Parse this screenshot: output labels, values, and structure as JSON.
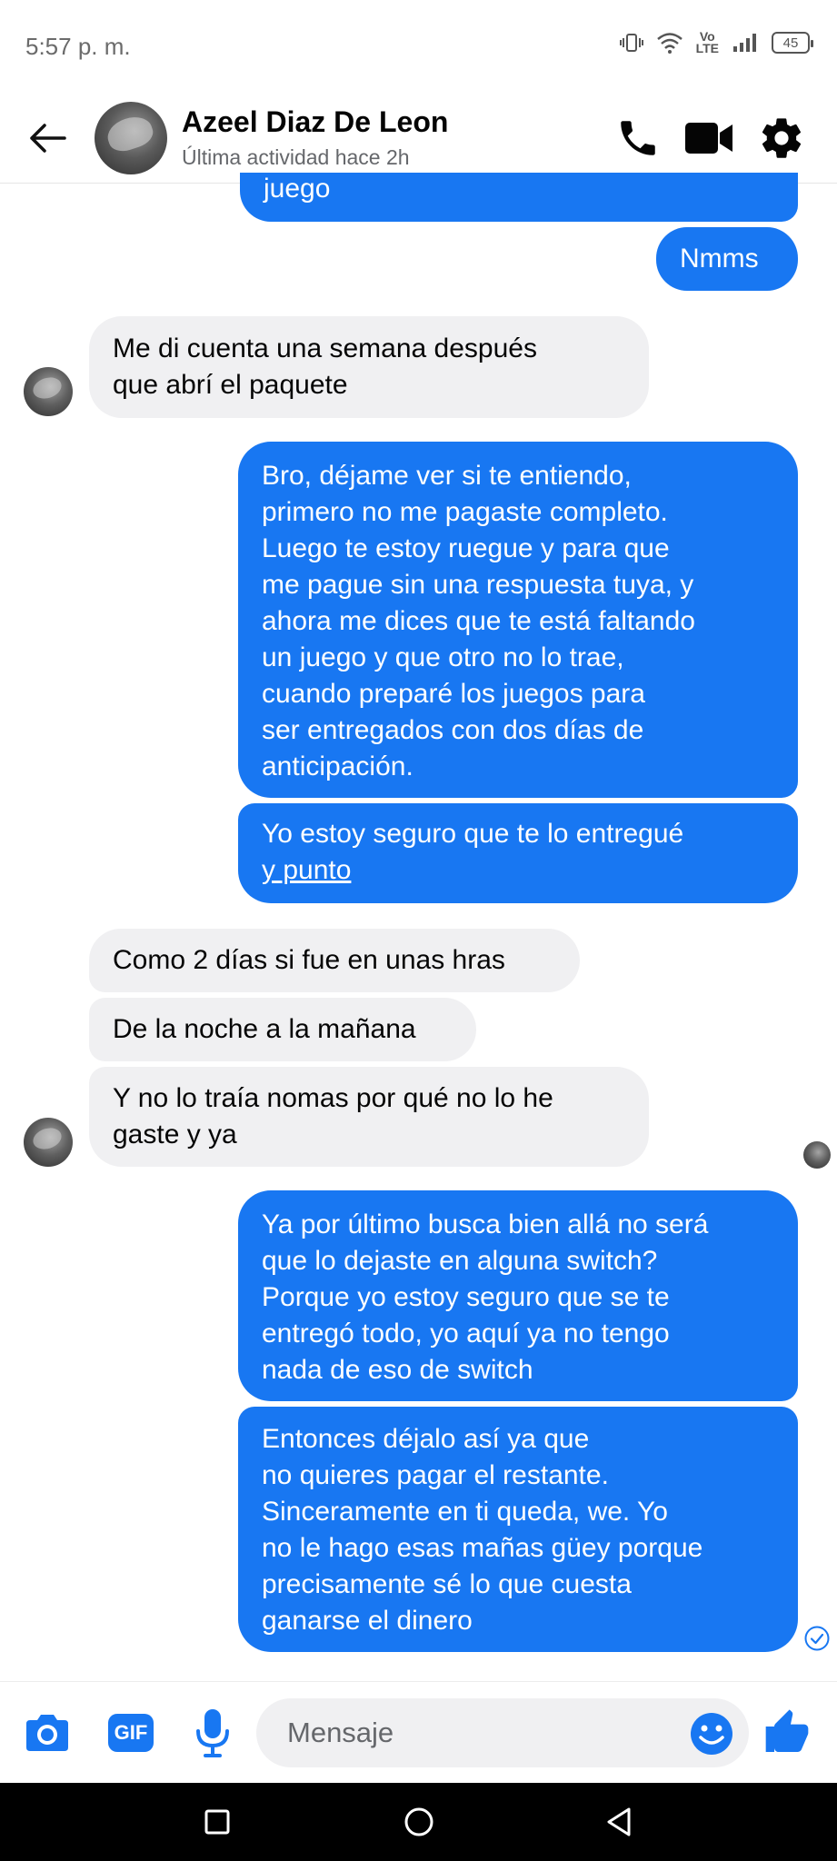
{
  "status_bar": {
    "time": "5:57 p. m.",
    "vol_top": "Vo",
    "vol_bottom": "LTE",
    "battery": "45",
    "icons": [
      "vibrate-icon",
      "wifi-icon",
      "volte-icon",
      "signal-icon",
      "battery-icon"
    ]
  },
  "header": {
    "name": "Azeel Diaz De Leon",
    "status": "Última actividad hace 2h",
    "icons": [
      "back-arrow-icon",
      "phone-icon",
      "video-camera-icon",
      "gear-icon"
    ]
  },
  "messages": [
    {
      "sender": "me",
      "lines": [
        "juego"
      ]
    },
    {
      "sender": "me",
      "lines": [
        "Nmms"
      ]
    },
    {
      "sender": "contact",
      "lines": [
        "Me di cuenta una semana después",
        "que abrí el paquete"
      ]
    },
    {
      "sender": "me",
      "lines": [
        "Bro, déjame ver si te entiendo,",
        "primero no me pagaste completo.",
        "Luego te estoy ruegue y para que",
        "me pague sin una respuesta tuya, y",
        "ahora me dices que te está faltando",
        "un juego y que otro no lo trae,",
        "cuando preparé los juegos para",
        "ser entregados con dos días de",
        "anticipación."
      ]
    },
    {
      "sender": "me",
      "lines": [
        "Yo estoy seguro que te lo entregué",
        "y punto"
      ]
    },
    {
      "sender": "contact",
      "lines": [
        "Como 2 días si fue en unas hras"
      ]
    },
    {
      "sender": "contact",
      "lines": [
        "De la noche a la mañana"
      ]
    },
    {
      "sender": "contact",
      "lines": [
        "Y no lo traía nomas por qué no lo he",
        "gaste y ya"
      ]
    },
    {
      "sender": "me",
      "lines": [
        "Ya por último busca bien allá no será",
        "que lo dejaste en alguna switch?",
        "Porque yo estoy seguro que se te",
        "entregó todo, yo aquí ya no tengo",
        "nada de eso de switch"
      ]
    },
    {
      "sender": "me",
      "lines": [
        "Entonces déjalo así ya que",
        "no quieres pagar el restante.",
        "Sinceramente en ti queda, we.  Yo",
        "no le hago esas mañas güey porque",
        "precisamente sé lo que cuesta",
        "ganarse el dinero"
      ]
    }
  ],
  "composer": {
    "placeholder": "Mensaje",
    "gif_label": "GIF",
    "icons": [
      "camera-icon",
      "gif-icon",
      "microphone-icon",
      "emoji-icon",
      "thumbs-up-icon"
    ]
  },
  "colors": {
    "accent": "#1877f2",
    "incoming_bubble": "#f0f0f2",
    "text": "#050505",
    "muted": "#65676b"
  }
}
